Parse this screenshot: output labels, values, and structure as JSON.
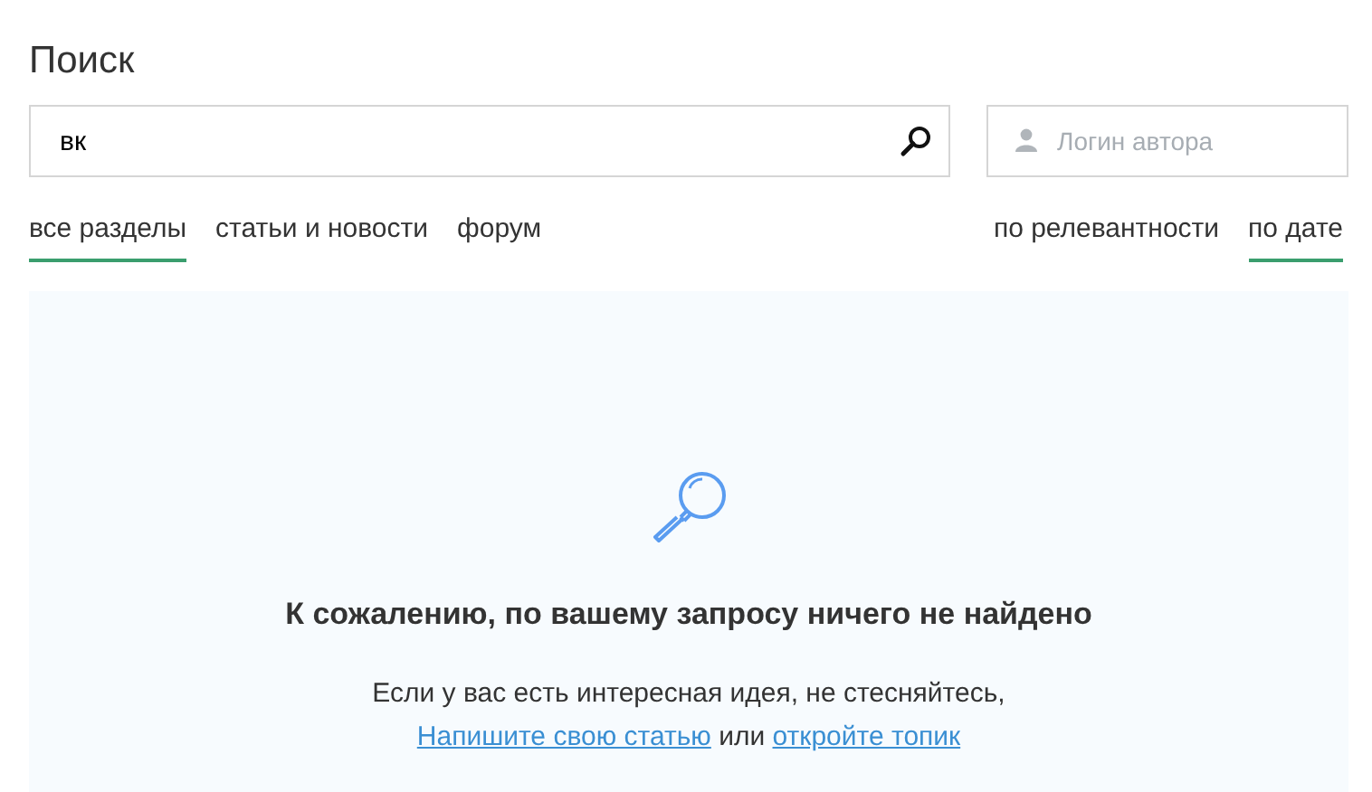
{
  "title": "Поиск",
  "search": {
    "value": "вк"
  },
  "author": {
    "placeholder": "Логин автора"
  },
  "sections": [
    {
      "label": "все разделы",
      "selected": true
    },
    {
      "label": "статьи и новости",
      "selected": false
    },
    {
      "label": "форум",
      "selected": false
    }
  ],
  "sort": [
    {
      "label": "по релевантности",
      "selected": false
    },
    {
      "label": "по дате",
      "selected": true
    }
  ],
  "empty": {
    "heading": "К сожалению, по вашему запросу ничего не найдено",
    "text": "Если у вас есть интересная идея, не стесняйтесь,",
    "link_1": "Напишите свою статью",
    "middle": "или",
    "link_2": "откройте топик"
  }
}
